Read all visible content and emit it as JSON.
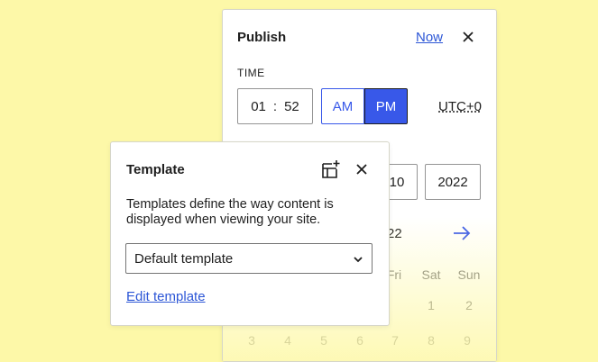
{
  "publish": {
    "title": "Publish",
    "now_label": "Now",
    "time_heading": "TIME",
    "hour": "01",
    "separator": ":",
    "minute": "52",
    "am_label": "AM",
    "pm_label": "PM",
    "timezone": "UTC+0",
    "day_value": "10",
    "year_value": "2022",
    "month_year_fragment": "22",
    "weekdays": [
      "Fri",
      "Sat",
      "Sun"
    ],
    "row1_days": [
      "1",
      "2"
    ],
    "row2_days": [
      "3",
      "4",
      "5",
      "6",
      "7",
      "8",
      "9"
    ]
  },
  "template": {
    "title": "Template",
    "description": "Templates define the way content is displayed when viewing your site.",
    "selected": "Default template",
    "edit_link": "Edit template"
  },
  "colors": {
    "accent": "#3858e9",
    "background": "#fdf8a8"
  }
}
